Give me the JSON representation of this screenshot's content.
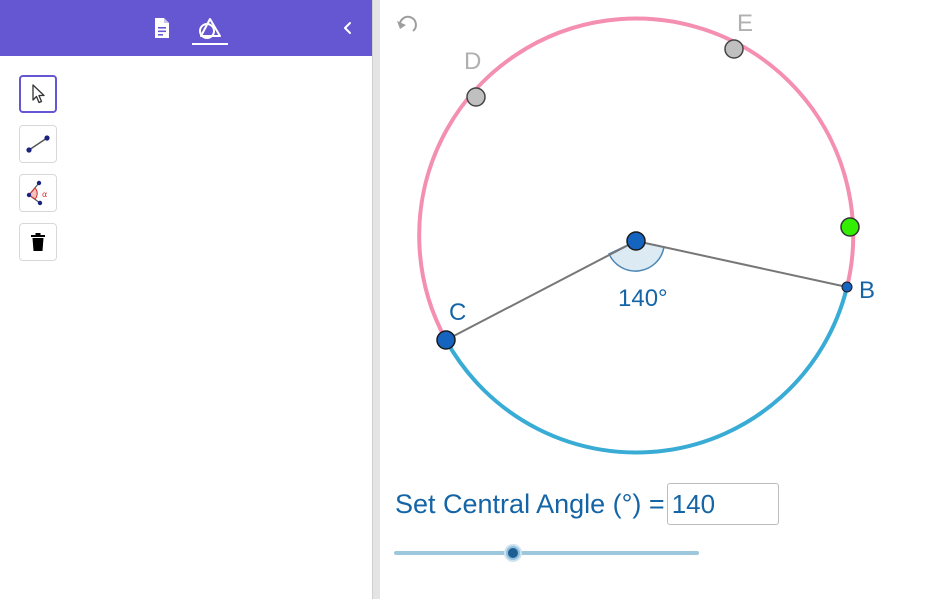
{
  "header": {
    "tabs": [
      {
        "name": "algebra",
        "icon": "document-icon"
      },
      {
        "name": "tools",
        "icon": "geometry-tools-icon"
      }
    ],
    "collapse_icon": "chevron-left-icon",
    "accent_color": "#6557d2"
  },
  "toolbar": {
    "tools": [
      {
        "name": "move",
        "icon": "pointer-icon",
        "active": true
      },
      {
        "name": "segment",
        "icon": "segment-icon",
        "active": false
      },
      {
        "name": "angle",
        "icon": "angle-icon",
        "active": false
      },
      {
        "name": "delete",
        "icon": "trash-icon",
        "active": false
      }
    ]
  },
  "canvas": {
    "undo_icon": "undo-icon",
    "points": {
      "C": "C",
      "B": "B",
      "D": "D",
      "E": "E"
    },
    "angle_label": "140°",
    "major_arc_color": "#f48fb1",
    "minor_arc_color": "#39acd6",
    "point_color": "#1565c0",
    "green_point_color": "#33ee00",
    "hidden_point_color": "#c0c0c0"
  },
  "controls": {
    "label": "Set Central Angle (°) =",
    "value": "140",
    "slider_level": 0.39
  }
}
